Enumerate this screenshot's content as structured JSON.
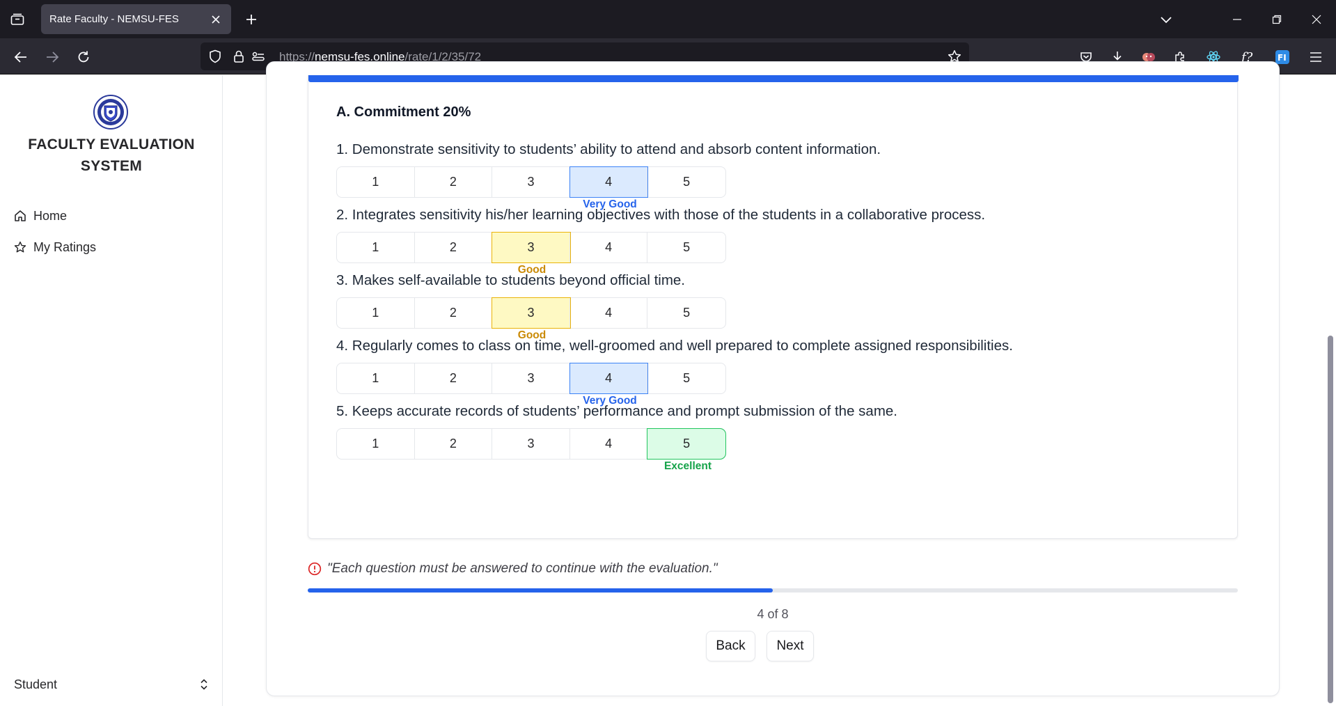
{
  "browser": {
    "tab_title": "Rate Faculty - NEMSU-FES",
    "url_prefix": "https://",
    "url_host": "nemsu-fes.online",
    "url_path": "/rate/1/2/35/72"
  },
  "sidebar": {
    "app_title": "FACULTY EVALUATION SYSTEM",
    "items": [
      {
        "label": "Home",
        "icon": "home-icon"
      },
      {
        "label": "My Ratings",
        "icon": "star-icon"
      }
    ],
    "role": "Student"
  },
  "form": {
    "section_title": "A. Commitment 20%",
    "options": [
      "1",
      "2",
      "3",
      "4",
      "5"
    ],
    "questions": [
      {
        "text": "1.  Demonstrate sensitivity to students’ ability to attend and absorb content information.",
        "selected": 4,
        "label": "Very Good"
      },
      {
        "text": "2.  Integrates sensitivity his/her learning objectives with those of the students in a collaborative process.",
        "selected": 3,
        "label": "Good"
      },
      {
        "text": "3.  Makes self-available to students beyond official time.",
        "selected": 3,
        "label": "Good"
      },
      {
        "text": "4.  Regularly comes to class on time, well-groomed and well prepared to complete assigned responsibilities.",
        "selected": 4,
        "label": "Very Good"
      },
      {
        "text": "5.  Keeps accurate records of students’ performance and prompt submission of the same.",
        "selected": 5,
        "label": "Excellent"
      }
    ],
    "warning": "\"Each question must be answered to continue with the evaluation.\"",
    "progress_fraction": 0.5,
    "step_text": "4 of 8",
    "back_label": "Back",
    "next_label": "Next"
  },
  "colors": {
    "accent": "#2563eb",
    "very_good": "#2563eb",
    "good": "#ca8a04",
    "excellent": "#16a34a",
    "warning_icon": "#dc2626"
  }
}
